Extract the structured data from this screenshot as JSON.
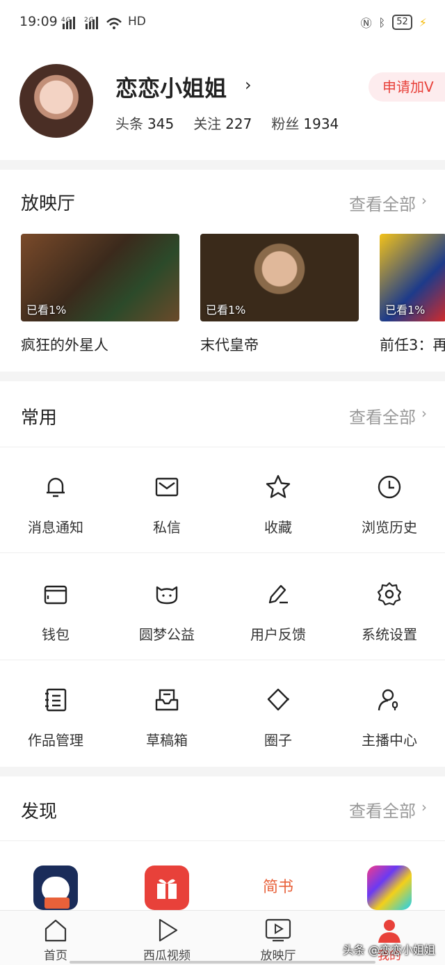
{
  "status": {
    "time": "19:09",
    "network": "4G 2G",
    "hd": "HD",
    "battery": "52"
  },
  "profile": {
    "name": "恋恋小姐姐",
    "stats": [
      {
        "label": "头条",
        "value": "345"
      },
      {
        "label": "关注",
        "value": "227"
      },
      {
        "label": "粉丝",
        "value": "1934"
      }
    ],
    "apply_v": "申请加V"
  },
  "cinema": {
    "title": "放映厅",
    "see_all": "查看全部",
    "movies": [
      {
        "title": "疯狂的外星人",
        "watched": "已看1%"
      },
      {
        "title": "末代皇帝",
        "watched": "已看1%"
      },
      {
        "title": "前任3：再",
        "watched": "已看1%"
      }
    ]
  },
  "common": {
    "title": "常用",
    "see_all": "查看全部",
    "tools": [
      {
        "label": "消息通知",
        "icon": "bell-icon"
      },
      {
        "label": "私信",
        "icon": "mail-icon"
      },
      {
        "label": "收藏",
        "icon": "star-icon"
      },
      {
        "label": "浏览历史",
        "icon": "clock-icon"
      },
      {
        "label": "钱包",
        "icon": "wallet-icon"
      },
      {
        "label": "圆梦公益",
        "icon": "cat-icon"
      },
      {
        "label": "用户反馈",
        "icon": "pen-icon"
      },
      {
        "label": "系统设置",
        "icon": "gear-icon"
      },
      {
        "label": "作品管理",
        "icon": "notebook-icon"
      },
      {
        "label": "草稿箱",
        "icon": "draft-icon"
      },
      {
        "label": "圈子",
        "icon": "circle-icon"
      },
      {
        "label": "主播中心",
        "icon": "streamer-icon"
      }
    ]
  },
  "discover": {
    "title": "发现",
    "see_all": "查看全部",
    "apps": [
      {
        "icon": "sheep-app-icon"
      },
      {
        "icon": "gift-app-icon"
      },
      {
        "label": "简书",
        "icon": "jianshu-app-icon"
      },
      {
        "icon": "puzzle-app-icon"
      }
    ]
  },
  "tabbar": {
    "tabs": [
      {
        "label": "首页",
        "icon": "home-icon"
      },
      {
        "label": "西瓜视频",
        "icon": "play-icon"
      },
      {
        "label": "放映厅",
        "icon": "tv-icon"
      },
      {
        "label": "我的",
        "icon": "user-icon"
      }
    ]
  },
  "watermark": "头条 @恋恋小姐姐",
  "colors": {
    "accent": "#e8413a",
    "muted": "#999999"
  }
}
